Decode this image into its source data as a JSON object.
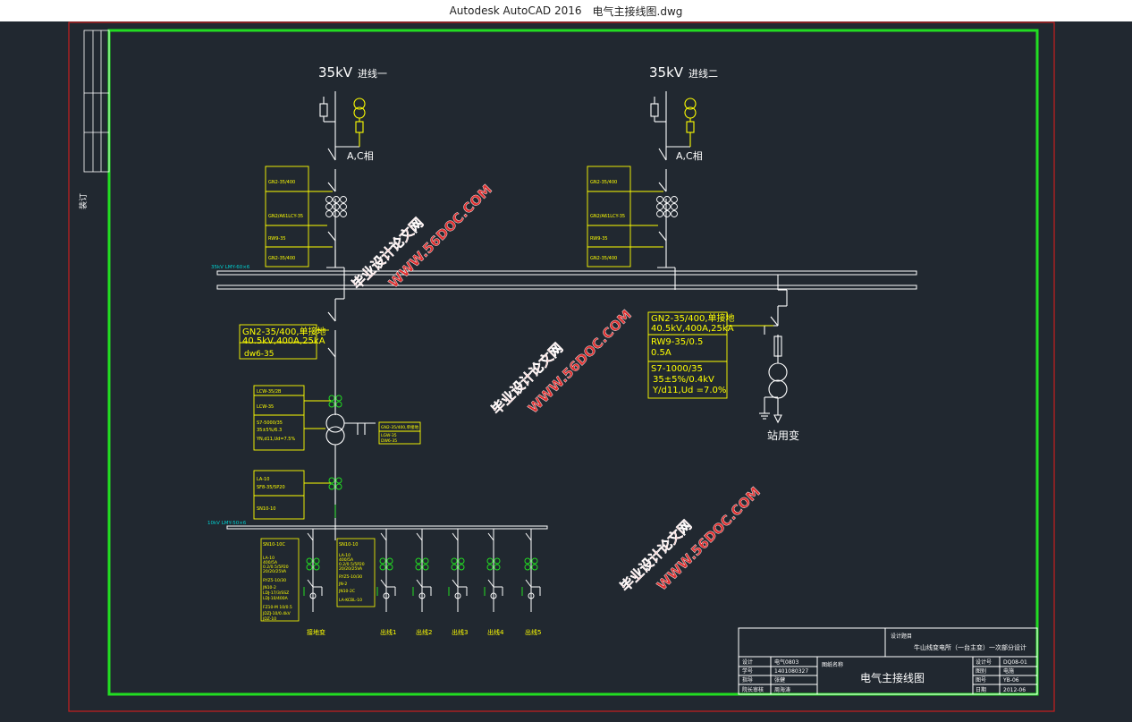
{
  "window": {
    "app_title": "Autodesk AutoCAD 2016",
    "file_name": "电气主接线图.dwg"
  },
  "colors": {
    "background": "#212830",
    "frame_green": "#22dd22",
    "outer_red": "#c81e1e",
    "wire": "#ffffff",
    "label_yellow": "#ffff00",
    "cyan": "#00d0d0",
    "watermark": "#e03030"
  },
  "sidebar": {
    "tag": "装订"
  },
  "incoming": {
    "line1_title": "35kV",
    "line1_suffix": "进线一",
    "line2_title": "35kV",
    "line2_suffix": "进线二",
    "phase_label": "A,C相",
    "labels": [
      "GN2-35/400",
      "GN2/A61LCY-35",
      "RW9-35",
      "GN2-35/400"
    ]
  },
  "bus": {
    "bus35_label": "35kV LMY-60×6",
    "bus10_label": "10kV LMY-50×6"
  },
  "main_branch": {
    "spec_line1": "GN2-35/400,单接地",
    "spec_line2": "40.5kV,400A,25kA",
    "spec_line3": "dw6-35",
    "ct_labels": [
      "LCW-35/2B",
      "LCW-35",
      "S7-5000/35",
      "35±5%/6.3",
      "YN,d11,Ud=7.5%"
    ],
    "side_box": [
      "GN2-35/400,单接地",
      "LGW-35",
      "DW6-35"
    ],
    "lower_labels": [
      "LA-10",
      "SF8-35/5P20",
      "SN10-10"
    ]
  },
  "station_transformer": {
    "spec_line1": "GN2-35/400,单接地",
    "spec_line2": "40.5kV,400A,25kA",
    "spec_line3": "RW9-35/0.5",
    "spec_line4": "0.5A",
    "spec_line5": "S7-1000/35",
    "spec_line6": "35±5%/0.4kV",
    "spec_line7": "Y/d11,Ud =7.0%",
    "name": "站用变"
  },
  "feeder_box1": [
    "SN10-10C",
    "LA-10",
    "400/5A",
    "0.2/0.5/5P20",
    "20/20/25VA",
    "RYZ5-10/30",
    "JN10-2",
    "LDJ-17/3/SSZ",
    "LDJ-10/400A"
  ],
  "feeder_box1_extra": [
    "FZ10-M 10/0.5",
    "JDZJ-10/0.4kV",
    "JDZ-10"
  ],
  "feeder_box2": [
    "SN10-10",
    "LA-10",
    "400/5A",
    "0.2/0.5/5P20",
    "20/20/25VA",
    "RYZ5-10/30",
    "JN-2",
    "JN10-2C",
    "LA-KCBL-10"
  ],
  "feeders": [
    "接地变",
    "出线1",
    "出线2",
    "出线3",
    "出线4",
    "出线5"
  ],
  "watermarks": [
    {
      "cn": "毕业设计论文网",
      "url": "WWW.56DOC.COM"
    },
    {
      "cn": "毕业设计论文网",
      "url": "WWW.56DOC.COM"
    },
    {
      "cn": "毕业设计论文网",
      "url": "WWW.56DOC.COM"
    }
  ],
  "title_block": {
    "design_label": "设计题目",
    "project_title": "牛山线变电所（一台主变）一次部分设计",
    "drawing_name_label": "图纸名称",
    "drawing_name": "电气主接线图",
    "rows_left": [
      [
        "设计",
        "电气0803"
      ],
      [
        "学号",
        "1401080327"
      ],
      [
        "指导",
        "张健"
      ],
      [
        "院长审核",
        "周海涛"
      ]
    ],
    "rows_right": [
      [
        "设计号",
        "DQ08-01"
      ],
      [
        "图别",
        "电施"
      ],
      [
        "图号",
        "YB-06"
      ],
      [
        "日期",
        "2012-06"
      ]
    ]
  }
}
